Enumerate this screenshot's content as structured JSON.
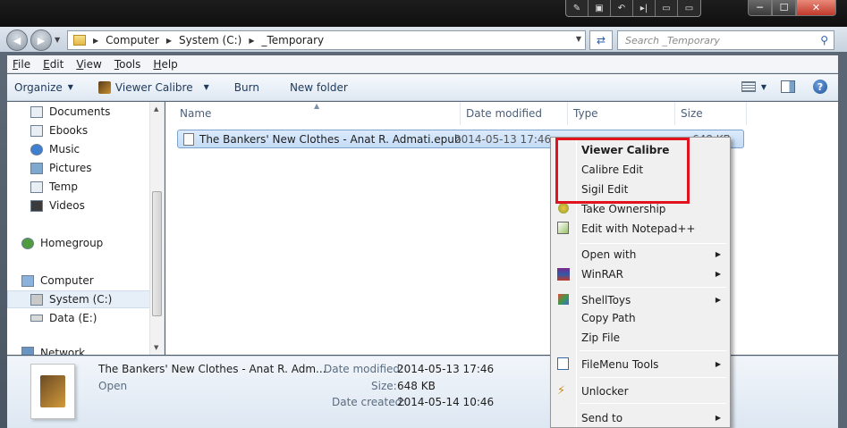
{
  "window": {
    "title_buttons": [
      "─",
      "☐",
      "✕"
    ]
  },
  "address": {
    "crumbs": [
      "Computer",
      "System (C:)",
      "_Temporary"
    ],
    "search_placeholder": "Search _Temporary"
  },
  "menubar": {
    "items": [
      {
        "label": "File",
        "key": "F"
      },
      {
        "label": "Edit",
        "key": "E"
      },
      {
        "label": "View",
        "key": "V"
      },
      {
        "label": "Tools",
        "key": "T"
      },
      {
        "label": "Help",
        "key": "H"
      }
    ]
  },
  "cmdbar": {
    "organize": "Organize",
    "viewer": "Viewer Calibre",
    "burn": "Burn",
    "new_folder": "New folder"
  },
  "nav": {
    "libraries": [
      "Documents",
      "Ebooks",
      "Music",
      "Pictures",
      "Temp",
      "Videos"
    ],
    "homegroup": "Homegroup",
    "computer": "Computer",
    "drives": [
      "System (C:)",
      "Data (E:)"
    ],
    "network": "Network"
  },
  "columns": {
    "name": "Name",
    "date": "Date modified",
    "type": "Type",
    "size": "Size"
  },
  "file": {
    "name": "The Bankers' New Clothes - Anat R. Admati.epub",
    "date": "2014-05-13 17:46",
    "size_partial": "648 KB"
  },
  "details": {
    "name": "The Bankers' New Clothes - Anat R. Adm...",
    "open": "Open",
    "date_modified_label": "Date modified:",
    "date_modified": "2014-05-13 17:46",
    "size_label": "Size:",
    "size": "648 KB",
    "date_created_label": "Date created:",
    "date_created": "2014-05-14 10:46"
  },
  "context_menu": {
    "viewer": "Viewer Calibre",
    "calibre_edit": "Calibre Edit",
    "sigil": "Sigil Edit",
    "ownership": "Take Ownership",
    "notepad": "Edit with Notepad++",
    "open_with": "Open with",
    "winrar": "WinRAR",
    "shelltoys": "ShellToys",
    "copy_path": "Copy Path",
    "zip": "Zip File",
    "filemenu": "FileMenu Tools",
    "unlocker": "Unlocker",
    "send_to": "Send to"
  },
  "colors": {
    "highlight": "#e0141e",
    "selection": "#c4dcf6"
  }
}
